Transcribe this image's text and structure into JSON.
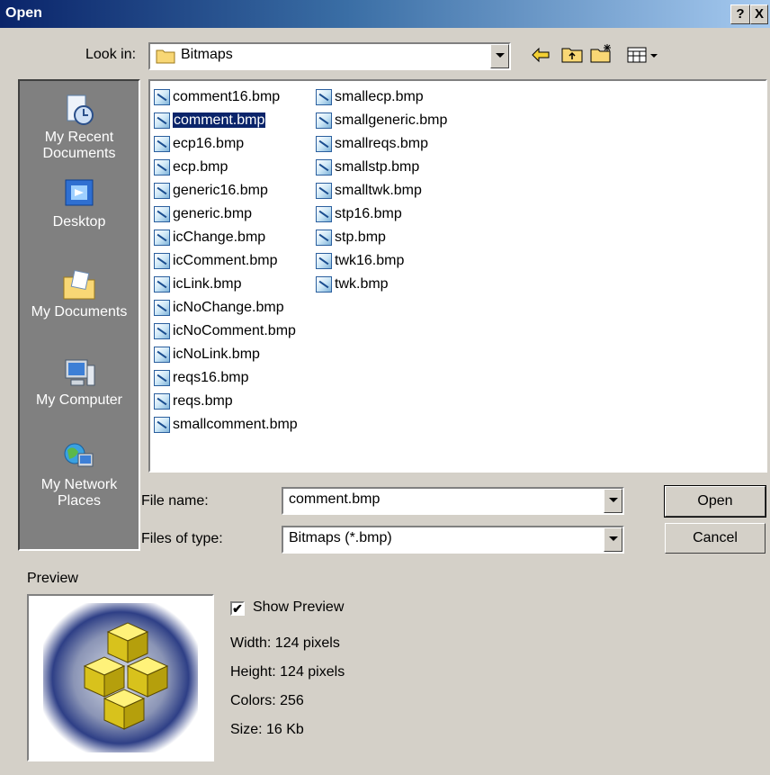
{
  "window": {
    "title": "Open",
    "help_btn": "?",
    "close_btn": "X"
  },
  "lookin": {
    "label": "Look in:",
    "value": "Bitmaps"
  },
  "places": [
    {
      "label": "My Recent Documents",
      "icon": "recent-documents-icon"
    },
    {
      "label": "Desktop",
      "icon": "desktop-icon"
    },
    {
      "label": "My Documents",
      "icon": "my-documents-icon"
    },
    {
      "label": "My Computer",
      "icon": "my-computer-icon"
    },
    {
      "label": "My Network Places",
      "icon": "network-places-icon"
    }
  ],
  "files_col1": [
    "comment16.bmp",
    "comment.bmp",
    "ecp16.bmp",
    "ecp.bmp",
    "generic16.bmp",
    "generic.bmp",
    "icChange.bmp",
    "icComment.bmp",
    "icLink.bmp",
    "icNoChange.bmp",
    "icNoComment.bmp",
    "icNoLink.bmp",
    "reqs16.bmp",
    "reqs.bmp",
    "smallcomment.bmp"
  ],
  "files_col2": [
    "smallecp.bmp",
    "smallgeneric.bmp",
    "smallreqs.bmp",
    "smallstp.bmp",
    "smalltwk.bmp",
    "stp16.bmp",
    "stp.bmp",
    "twk16.bmp",
    "twk.bmp"
  ],
  "selected_file": "comment.bmp",
  "filename": {
    "label": "File name:",
    "value": "comment.bmp"
  },
  "filetype": {
    "label": "Files of type:",
    "value": "Bitmaps (*.bmp)"
  },
  "buttons": {
    "open": "Open",
    "cancel": "Cancel"
  },
  "preview": {
    "label": "Preview",
    "show_preview": "Show Preview",
    "show_checked": true,
    "width": "Width: 124 pixels",
    "height": "Height: 124 pixels",
    "colors": "Colors: 256",
    "size": "Size: 16 Kb"
  }
}
